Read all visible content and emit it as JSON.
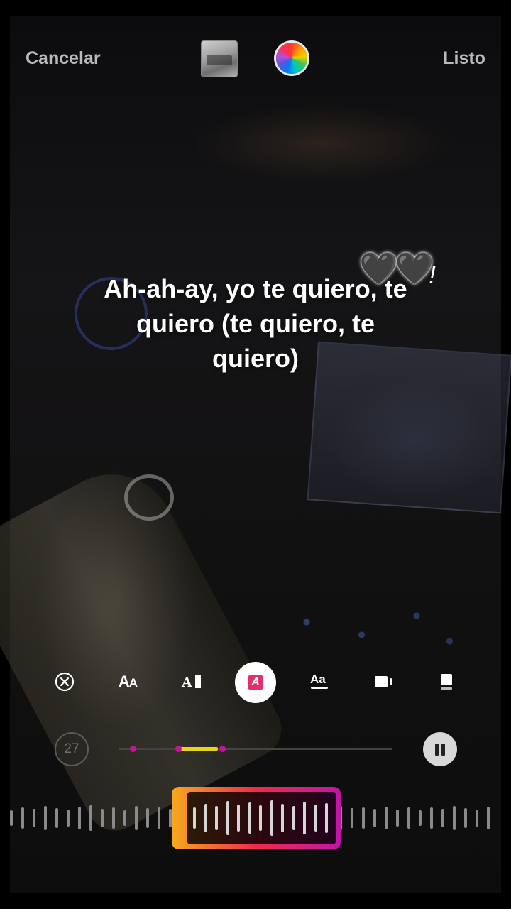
{
  "header": {
    "cancel_label": "Cancelar",
    "done_label": "Listo"
  },
  "lyrics": {
    "text": "Ah-ah-ay, yo te quiero, te quiero (te quiero, te quiero)",
    "hearts": "🖤🖤",
    "exclamation": "!"
  },
  "toolbar": {
    "items": [
      {
        "name": "remove-lyrics-icon",
        "glyph": "⊗"
      },
      {
        "name": "text-style-size-icon",
        "glyph": "AA"
      },
      {
        "name": "text-style-typewriter-icon",
        "glyph": "A▮"
      },
      {
        "name": "text-style-highlight-icon",
        "glyph": "A",
        "selected": true
      },
      {
        "name": "text-style-underline-icon",
        "glyph": "Aa"
      },
      {
        "name": "text-style-card-icon",
        "glyph": "▮"
      },
      {
        "name": "text-style-box-icon",
        "glyph": "▮"
      }
    ],
    "accent_color": "#e1306c"
  },
  "playback": {
    "duration_seconds": "27",
    "is_playing": true,
    "progress_segment_color": "#e9d31c",
    "marker_color": "#c2169a"
  },
  "scrubber": {
    "gradient_colors": [
      "#f6a91d",
      "#ee2b4a",
      "#c215a8"
    ]
  }
}
